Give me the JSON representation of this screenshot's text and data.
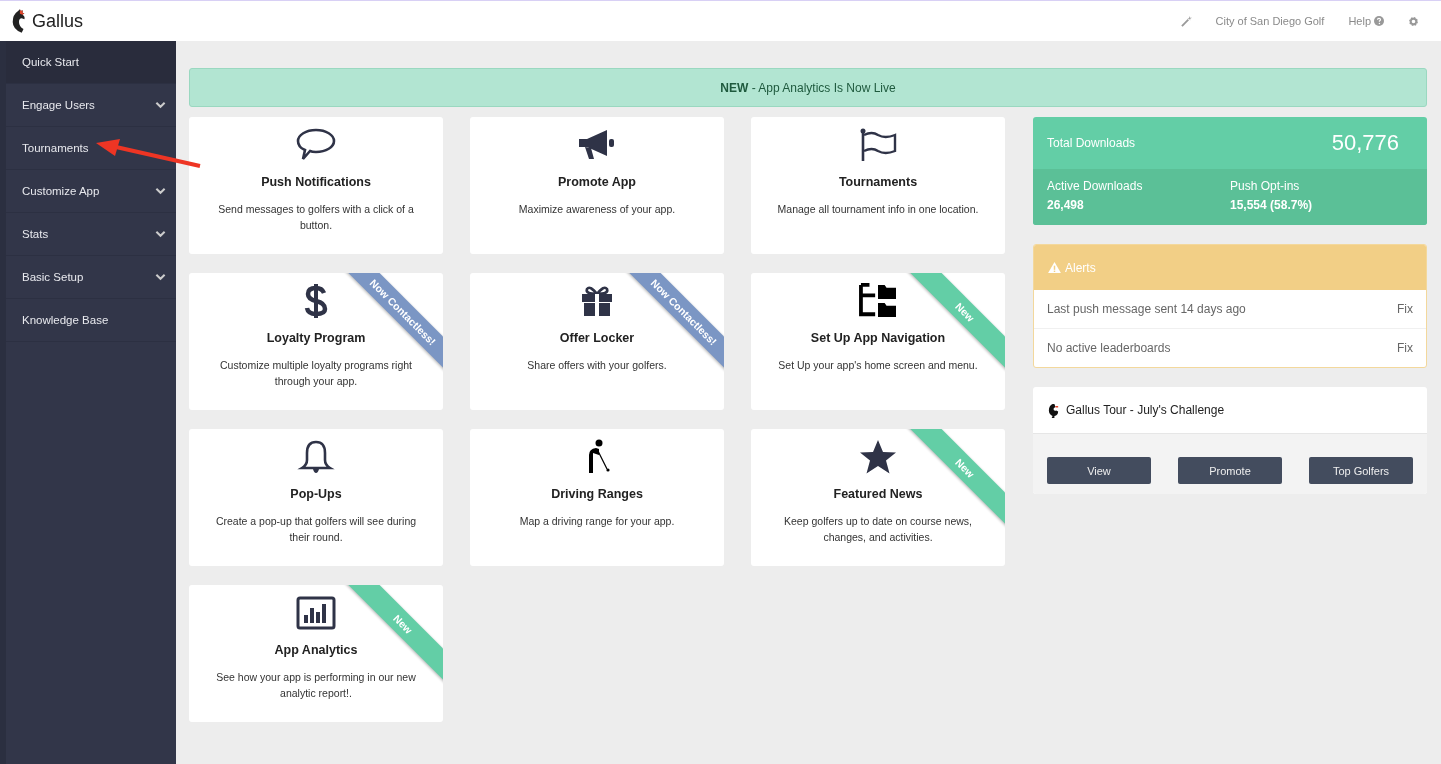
{
  "header": {
    "brand": "Gallus",
    "links": [
      {
        "kind": "wand"
      },
      {
        "kind": "text",
        "label": "City of San Diego Golf"
      },
      {
        "kind": "help",
        "label": "Help"
      },
      {
        "kind": "gear"
      }
    ]
  },
  "sidebar": {
    "items": [
      {
        "label": "Quick Start",
        "kind": "link",
        "selected": true
      },
      {
        "label": "Engage Users",
        "kind": "group",
        "selected": false
      },
      {
        "label": "Tournaments",
        "kind": "link",
        "selected": false
      },
      {
        "label": "Customize App",
        "kind": "group",
        "selected": false
      },
      {
        "label": "Stats",
        "kind": "group",
        "selected": false
      },
      {
        "label": "Basic Setup",
        "kind": "group",
        "selected": false
      },
      {
        "label": "Knowledge Base",
        "kind": "link",
        "selected": false
      }
    ]
  },
  "banner": {
    "text": "**NEW** - App Analytics Is Now Live"
  },
  "cards": [
    {
      "title": "Push Notifications",
      "description": "Send messages to golfers with a click of a button."
    },
    {
      "title": "Promote App",
      "description": "Maximize awareness of your app."
    },
    {
      "title": "Tournaments",
      "description": "Manage all tournament info in one location."
    },
    {
      "title": "Loyalty Program",
      "description": "Customize multiple loyalty programs right through your app.",
      "ribbon": {
        "text": "Now Contactless!",
        "color": "#7b96c4"
      }
    },
    {
      "title": "Offer Locker",
      "description": "Share offers with your golfers.",
      "ribbon": {
        "text": "Now Contactless!",
        "color": "#7b96c4"
      }
    },
    {
      "title": "Set Up App Navigation",
      "description": "Set Up your app's home screen and menu.",
      "ribbon": {
        "text": "New",
        "color": "#63cea6"
      }
    },
    {
      "title": "Pop-Ups",
      "description": "Create a pop-up that golfers will see during their round."
    },
    {
      "title": "Driving Ranges",
      "description": "Map a driving range for your app."
    },
    {
      "title": "Featured News",
      "description": "Keep golfers up to date on course news, changes, and activities.",
      "ribbon": {
        "text": "New",
        "color": "#63cea6"
      }
    },
    {
      "title": "App Analytics",
      "description": "See how your app is performing in our new analytic report!.",
      "ribbon": {
        "text": "New",
        "color": "#63cea6"
      }
    }
  ],
  "downloads": {
    "total_label": "Total Downloads",
    "total": "50,776",
    "stats": [
      {
        "label": "Active Downloads",
        "value": "26,498"
      },
      {
        "label": "Push Opt-ins",
        "value": "15,554 (58.7%)"
      }
    ]
  },
  "alerts": {
    "title": "Alerts",
    "items": [
      {
        "text": "Last push message sent 14 days ago",
        "action": "Fix"
      },
      {
        "text": "No active leaderboards",
        "action": "Fix"
      }
    ]
  },
  "tour": {
    "title": "Gallus Tour - July's Challenge",
    "buttons": [
      "View",
      "Promote",
      "Top Golfers"
    ]
  }
}
